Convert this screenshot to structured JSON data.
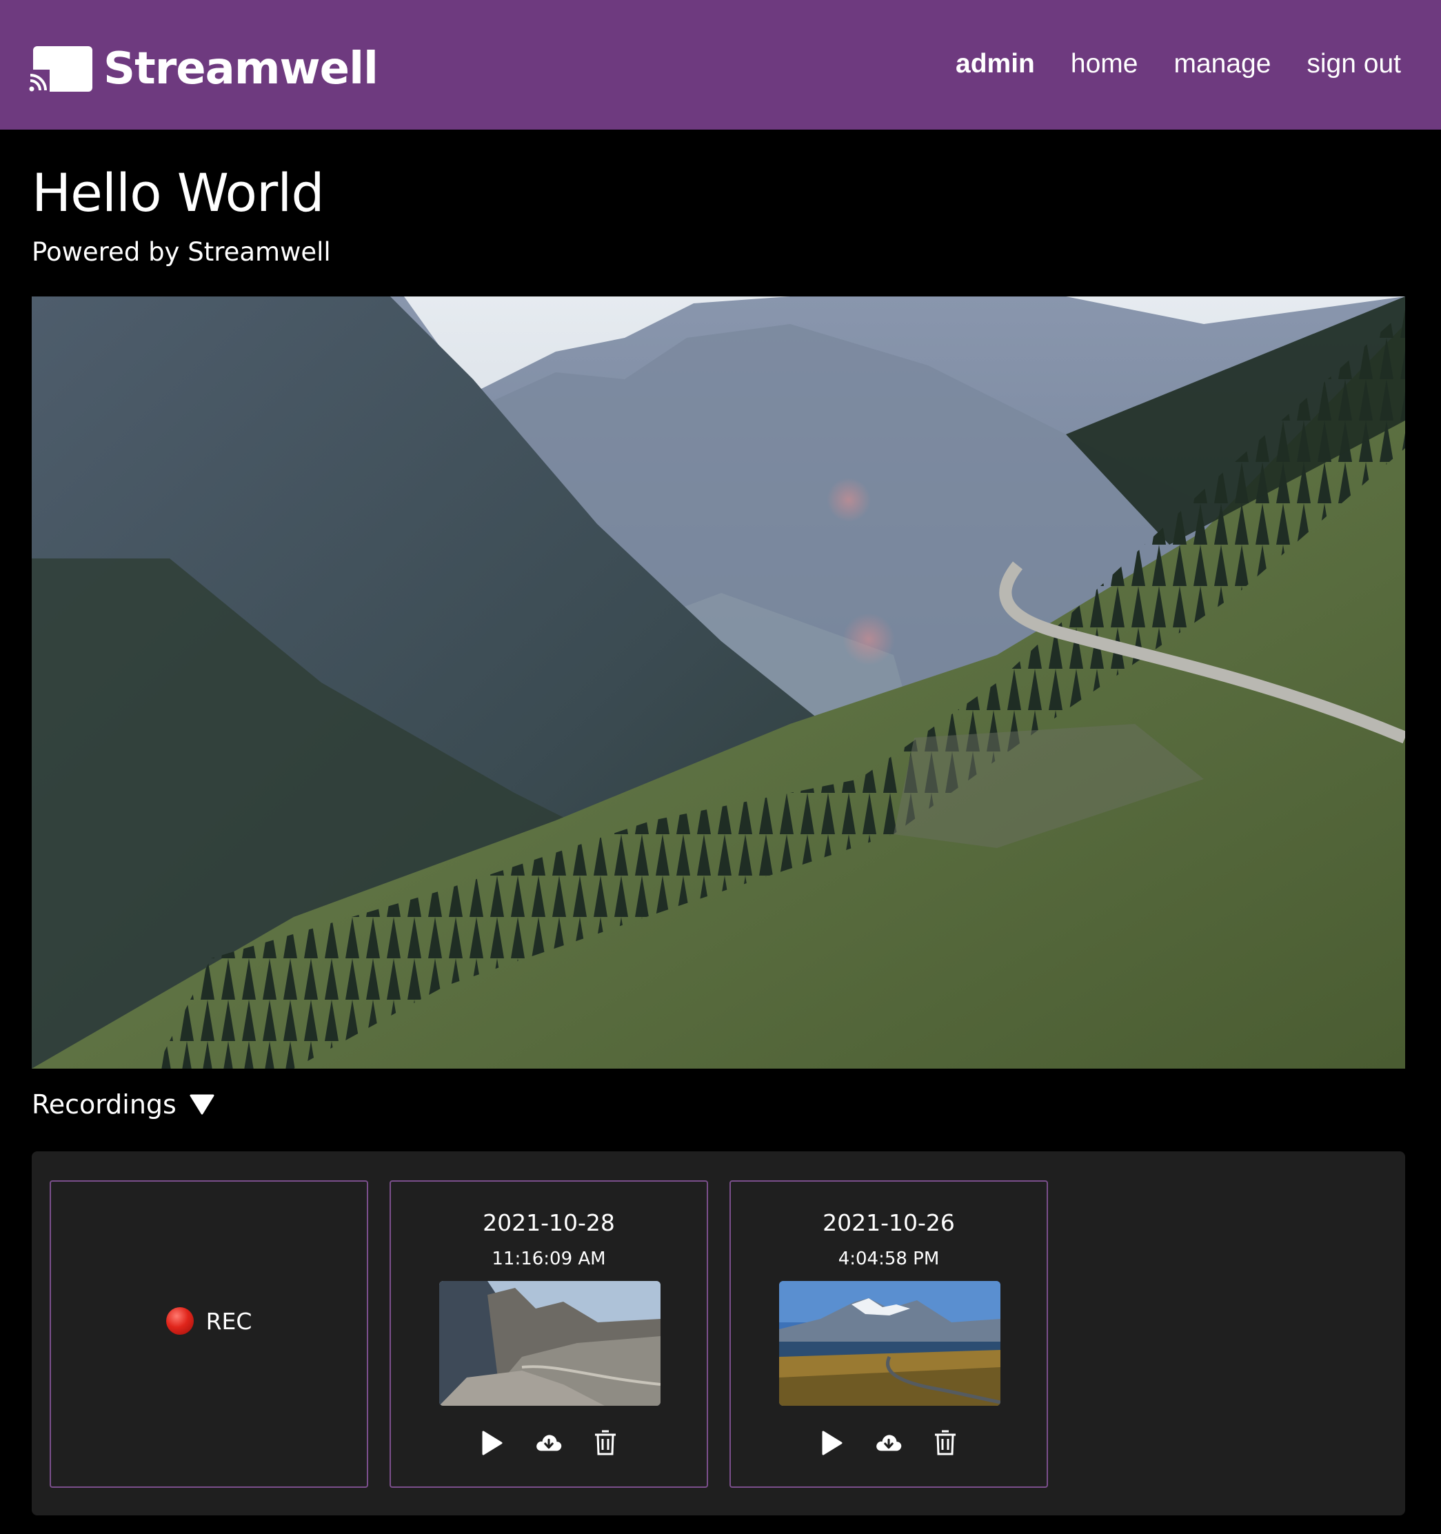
{
  "header": {
    "brand": "Streamwell",
    "nav": [
      "admin",
      "home",
      "manage",
      "sign out"
    ],
    "accent_color": "#6e3a7f"
  },
  "page": {
    "title": "Hello World",
    "subtitle": "Powered by Streamwell"
  },
  "player": {
    "content": "video-frame"
  },
  "recordings": {
    "toggle_label": "Recordings",
    "toggle_icon": "triangle-down-icon",
    "live": {
      "label": "REC",
      "icon": "red-circle-icon"
    },
    "items": [
      {
        "date": "2021-10-28",
        "time": "11:16:09 AM",
        "actions": [
          "play-icon",
          "download-cloud-icon",
          "trash-icon"
        ]
      },
      {
        "date": "2021-10-26",
        "time": "4:04:58 PM",
        "actions": [
          "play-icon",
          "download-cloud-icon",
          "trash-icon"
        ]
      }
    ]
  }
}
